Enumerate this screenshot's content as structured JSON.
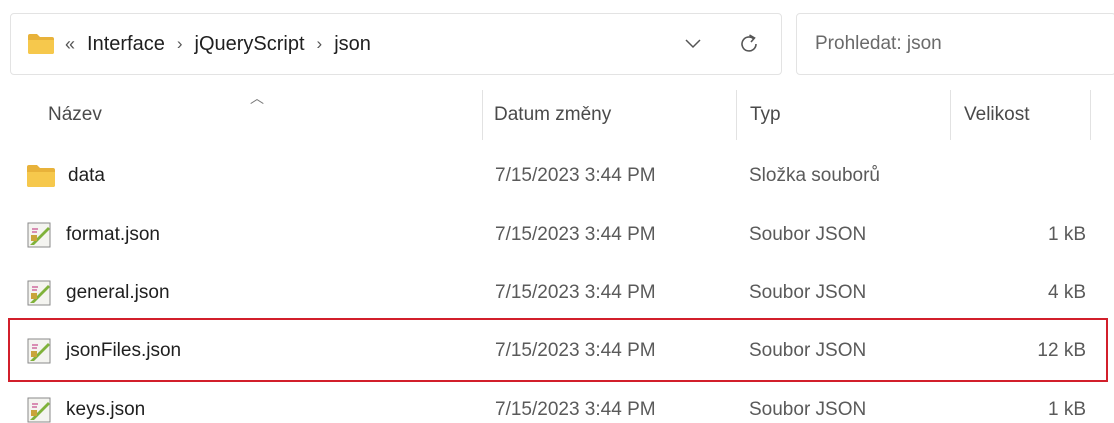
{
  "address_bar": {
    "overflow": "«",
    "crumbs": [
      "Interface",
      "jQueryScript",
      "json"
    ],
    "separator": "›"
  },
  "search": {
    "placeholder": "Prohledat: json"
  },
  "columns": {
    "name": "Název",
    "date": "Datum změny",
    "type": "Typ",
    "size": "Velikost"
  },
  "rows": [
    {
      "name": "data",
      "date": "7/15/2023 3:44 PM",
      "type": "Složka souborů",
      "size": "",
      "icon": "folder-icon"
    },
    {
      "name": "format.json",
      "date": "7/15/2023 3:44 PM",
      "type": "Soubor JSON",
      "size": "1 kB",
      "icon": "json-file-icon"
    },
    {
      "name": "general.json",
      "date": "7/15/2023 3:44 PM",
      "type": "Soubor JSON",
      "size": "4 kB",
      "icon": "json-file-icon"
    },
    {
      "name": "jsonFiles.json",
      "date": "7/15/2023 3:44 PM",
      "type": "Soubor JSON",
      "size": "12 kB",
      "icon": "json-file-icon",
      "highlighted": true
    },
    {
      "name": "keys.json",
      "date": "7/15/2023 3:44 PM",
      "type": "Soubor JSON",
      "size": "1 kB",
      "icon": "json-file-icon"
    }
  ],
  "colors": {
    "highlight_border": "#d21f2b",
    "folder": "#f6c84c"
  }
}
